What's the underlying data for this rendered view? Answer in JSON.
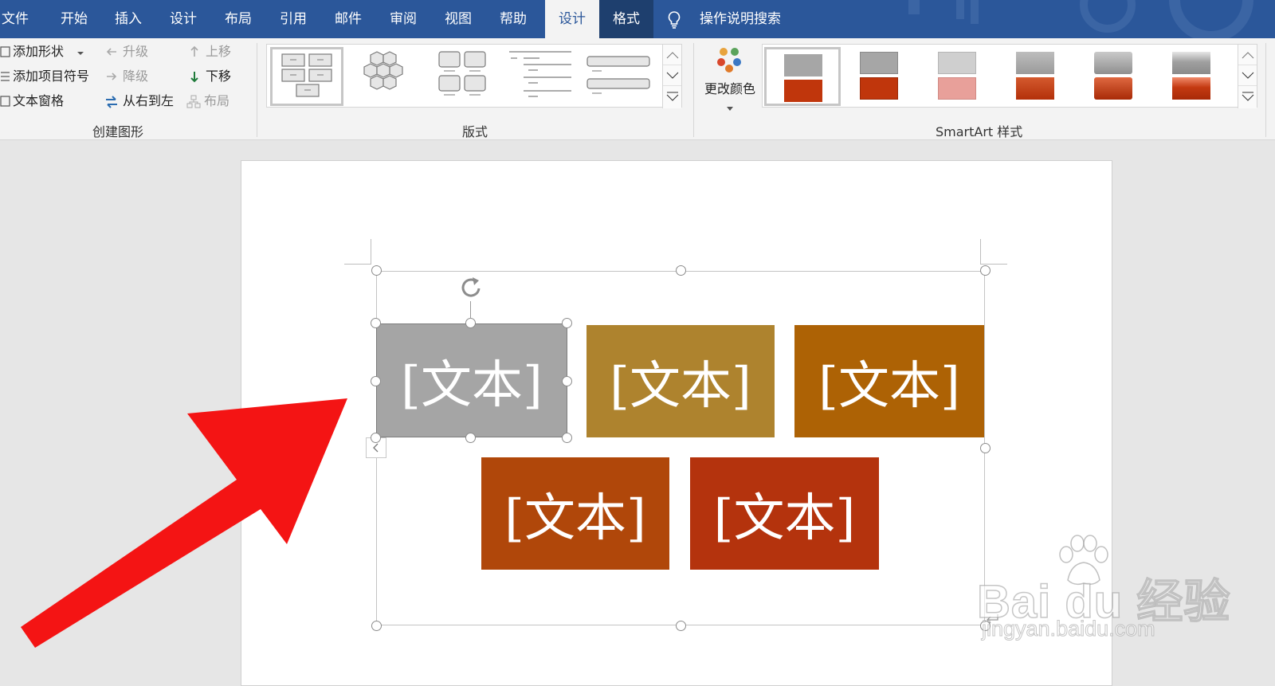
{
  "tabs": [
    {
      "label": "文件"
    },
    {
      "label": "开始"
    },
    {
      "label": "插入"
    },
    {
      "label": "设计"
    },
    {
      "label": "布局"
    },
    {
      "label": "引用"
    },
    {
      "label": "邮件"
    },
    {
      "label": "审阅"
    },
    {
      "label": "视图"
    },
    {
      "label": "帮助"
    },
    {
      "label": "设计"
    },
    {
      "label": "格式"
    }
  ],
  "search": {
    "label": "操作说明搜索",
    "icon": "lightbulb-icon"
  },
  "ribbon": {
    "create_graphic": {
      "label": "创建图形",
      "add_shape": "添加形状",
      "add_bullet": "添加项目符号",
      "text_pane": "文本窗格",
      "promote": "升级",
      "demote": "降级",
      "right_to_left": "从右到左",
      "move_up": "上移",
      "move_down": "下移",
      "layout": "布局"
    },
    "layouts": {
      "label": "版式"
    },
    "change_colors": {
      "label": "更改颜色"
    },
    "smartart_styles": {
      "label": "SmartArt 样式"
    }
  },
  "colors": {
    "tab_bar": "#2b579a",
    "accent_red": "#c0360c",
    "arrow_red": "#f41414"
  },
  "smartart": {
    "boxes": [
      {
        "text": "[文本]",
        "color": "#a5a5a5"
      },
      {
        "text": "[文本]",
        "color": "#ae832e"
      },
      {
        "text": "[文本]",
        "color": "#ad6205"
      },
      {
        "text": "[文本]",
        "color": "#b0470a"
      },
      {
        "text": "[文本]",
        "color": "#b4330d"
      }
    ]
  },
  "watermark": {
    "brand": "Bai du 经验",
    "url": "jingyan.baidu.com"
  }
}
